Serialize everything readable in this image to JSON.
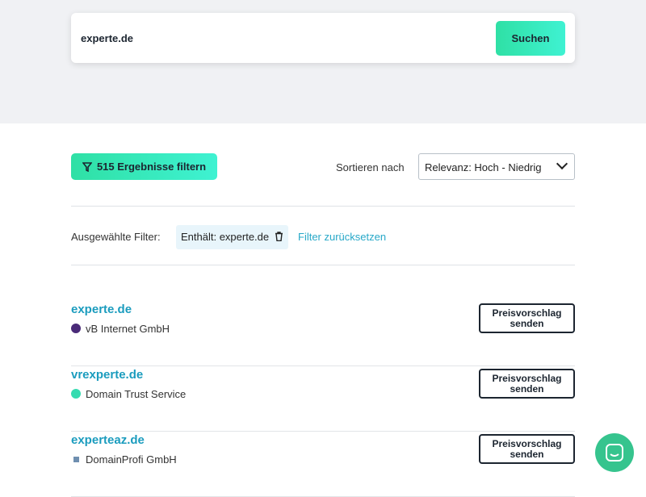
{
  "search": {
    "value": "experte.de",
    "button": "Suchen"
  },
  "toolbar": {
    "filter_button": "515 Ergebnisse filtern",
    "sort_label": "Sortieren nach",
    "sort_value": "Relevanz: Hoch - Niedrig"
  },
  "filters": {
    "label": "Ausgewählte Filter:",
    "chip": "Enthält: experte.de",
    "reset": "Filter zurücksetzen"
  },
  "results": [
    {
      "domain": "experte.de",
      "registrar": "vB Internet GmbH",
      "color": "#4a2a78",
      "button": "Preisvorschlag senden"
    },
    {
      "domain": "vrexperte.de",
      "registrar": "Domain Trust Service",
      "color": "#36dbb0",
      "button": "Preisvorschlag senden"
    },
    {
      "domain": "experteaz.de",
      "registrar": "DomainProfi GmbH",
      "color": "#6f8fb0",
      "button": "Preisvorschlag senden"
    }
  ]
}
